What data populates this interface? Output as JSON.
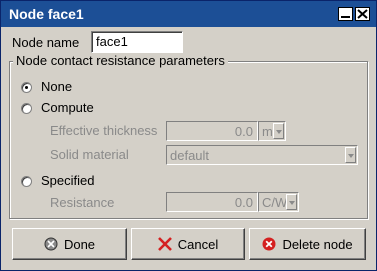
{
  "window": {
    "title": "Node face1"
  },
  "node_name": {
    "label": "Node name",
    "value": "face1"
  },
  "group": {
    "title": "Node contact resistance parameters",
    "options": {
      "none": "None",
      "compute": "Compute",
      "specified": "Specified"
    },
    "selected": "None"
  },
  "compute": {
    "effective_thickness": {
      "label": "Effective thickness",
      "value": "0.0",
      "unit": "m"
    },
    "solid_material": {
      "label": "Solid material",
      "value": "default"
    }
  },
  "specified": {
    "resistance": {
      "label": "Resistance",
      "value": "0.0",
      "unit": "C/W"
    }
  },
  "buttons": {
    "done": "Done",
    "cancel": "Cancel",
    "delete": "Delete node"
  },
  "colors": {
    "titlebar": "#1c4f96",
    "face": "#d4d0c8",
    "disabled_text": "#8a8a8a",
    "delete_icon": "#d42020"
  }
}
